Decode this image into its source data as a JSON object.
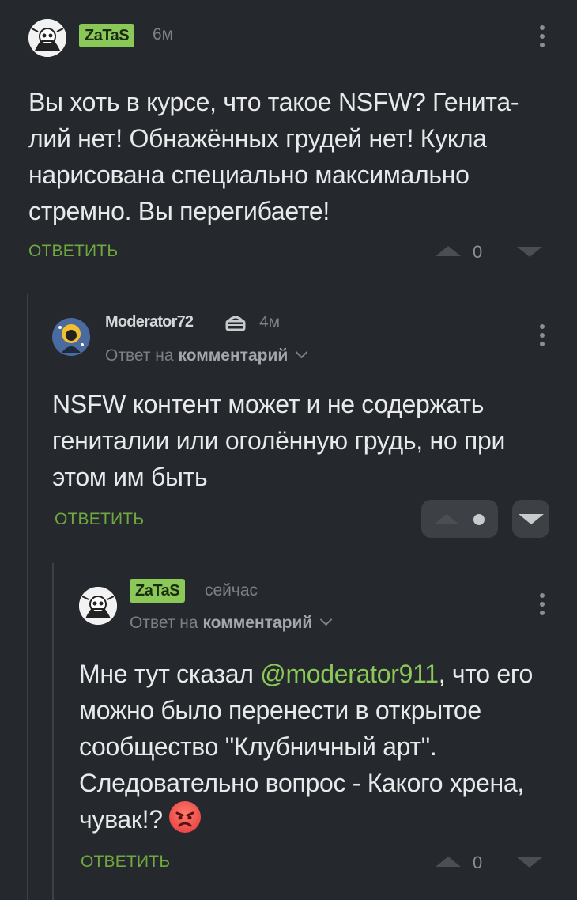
{
  "comments": [
    {
      "author": "ZaTaS",
      "time": "6м",
      "text": "Вы хоть в курсе, что такое NSFW? Генита-лий нет! Обнажённых грудей нет! Кукла нарисована специально максимально стремно. Вы перегибаете!",
      "lines": [
        "Вы хоть в курсе, что такое NSFW? Генита-",
        "лий нет! Обнажённых грудей нет! Кукла",
        "нарисована специально максимально",
        "стремно. Вы перегибаете!"
      ],
      "reply_label": "ОТВЕТИТЬ",
      "score": "0"
    },
    {
      "author": "Moderator72",
      "time": "4м",
      "reply_prefix": "Ответ на",
      "reply_target": "комментарий",
      "lines": [
        "NSFW контент может и не содержать",
        "гениталии или оголённую грудь, но при",
        "этом им быть"
      ],
      "reply_label": "ОТВЕТИТЬ",
      "score": ""
    },
    {
      "author": "ZaTaS",
      "time": "сейчас",
      "reply_prefix": "Ответ на",
      "reply_target": "комментарий",
      "line1_a": "Мне тут сказал ",
      "mention": "@moderator911",
      "line1_b": ", что его",
      "lines": [
        "можно было перенести в открытое",
        "сообщество \"Клубничный арт\".",
        "Следовательно вопрос - Какого хрена,"
      ],
      "last_line": "чувак!? ",
      "reply_label": "ОТВЕТИТЬ",
      "score": "0"
    }
  ],
  "colors": {
    "accent": "#8ac858",
    "background": "#25282c",
    "reply": "#6fa83f"
  },
  "icons": [
    "kebab-menu-icon",
    "moderator-cake-icon",
    "chevron-down-icon",
    "angry-face-emoji"
  ]
}
